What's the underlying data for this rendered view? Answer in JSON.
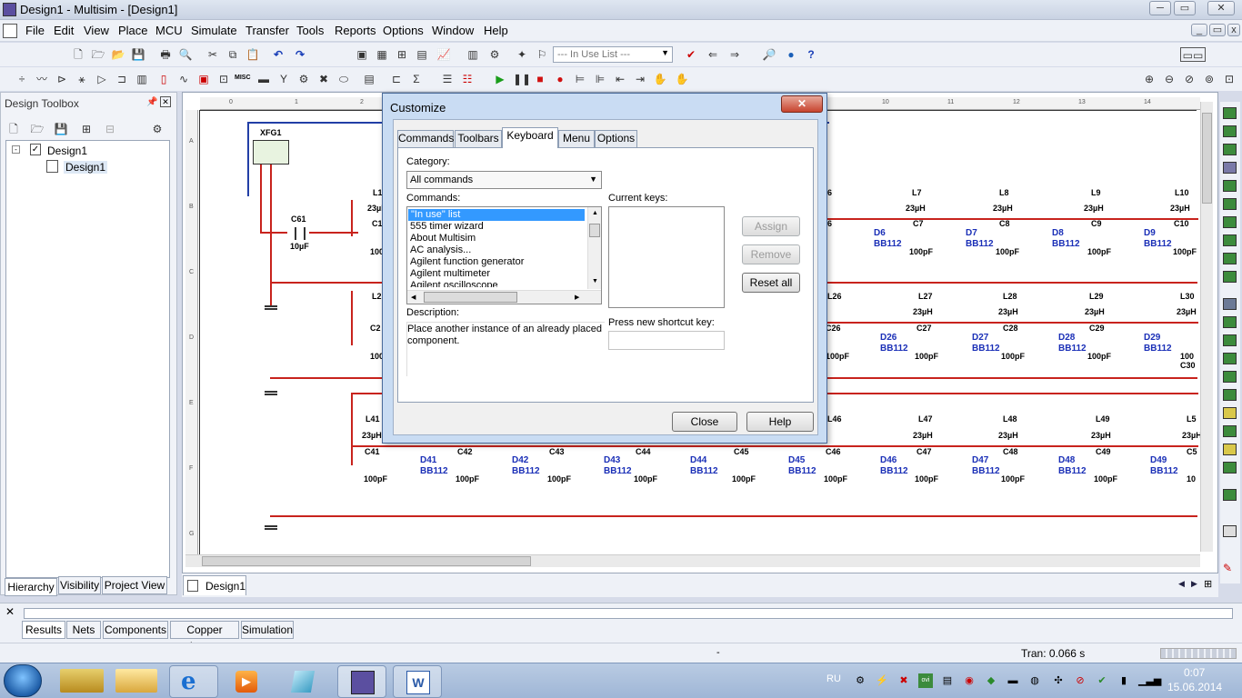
{
  "app": {
    "title": "Design1 - Multisim - [Design1]",
    "window_buttons": [
      "─",
      "▭",
      "✕"
    ]
  },
  "menu": [
    "File",
    "Edit",
    "View",
    "Place",
    "MCU",
    "Simulate",
    "Transfer",
    "Tools",
    "Reports",
    "Options",
    "Window",
    "Help"
  ],
  "toolbar": {
    "in_use_list_placeholder": "--- In Use List ---",
    "misc_label": "MISC"
  },
  "toolbox": {
    "title": "Design Toolbox",
    "tree": [
      "Design1",
      "Design1"
    ],
    "tabs": [
      "Hierarchy",
      "Visibility",
      "Project View"
    ]
  },
  "schematic": {
    "doc_tab": "Design1",
    "ruler_cols": [
      "0",
      "1",
      "2",
      "10",
      "11",
      "12",
      "13",
      "14"
    ],
    "ruler_rows": [
      "A",
      "B",
      "C",
      "D",
      "E",
      "F",
      "G"
    ],
    "xfg": "XFG1",
    "c61": {
      "name": "C61",
      "value": "10µF"
    },
    "row1": {
      "inductors": [
        "L1",
        "L7",
        "L8",
        "L9",
        "L10"
      ],
      "caps": [
        "C1",
        "C7",
        "C8",
        "C9",
        "C10",
        "6"
      ],
      "diodes": [
        "D6",
        "D7",
        "D8",
        "D9"
      ]
    },
    "row2": {
      "inductors": [
        "L2",
        "L26",
        "L27",
        "L28",
        "L29",
        "L30"
      ],
      "caps": [
        "C2",
        "C26",
        "C27",
        "C28",
        "C29",
        "C30"
      ],
      "diodes": [
        "D26",
        "D27",
        "D28",
        "D29"
      ]
    },
    "row3": {
      "inductors": [
        "L41",
        "L46",
        "L47",
        "L48",
        "L49",
        "L5"
      ],
      "caps": [
        "C41",
        "C42",
        "C43",
        "C44",
        "C45",
        "C46",
        "C47",
        "C48",
        "C49",
        "C5"
      ],
      "diodes": [
        "D41",
        "D42",
        "D43",
        "D44",
        "D45",
        "D46",
        "D47",
        "D48",
        "D49"
      ]
    },
    "inductance": "23µH",
    "capacitance": "100pF",
    "diode_model": "BB112",
    "trunc_cap": "100",
    "trunc_cap2": "10"
  },
  "dialog": {
    "title": "Customize",
    "close": "✕",
    "tabs": [
      "Commands",
      "Toolbars",
      "Keyboard",
      "Menu",
      "Options"
    ],
    "active_tab": "Keyboard",
    "category_label": "Category:",
    "category_value": "All commands",
    "commands_label": "Commands:",
    "commands": [
      "\"In use\" list",
      "555 timer wizard",
      "About Multisim",
      "AC analysis...",
      "Agilent function generator",
      "Agilent multimeter",
      "Agilent oscilloscope"
    ],
    "current_keys_label": "Current keys:",
    "assign": "Assign",
    "remove": "Remove",
    "reset_all": "Reset all",
    "description_label": "Description:",
    "description": "Place another instance of an already placed component.",
    "shortcut_label": "Press new shortcut key:",
    "close_button": "Close",
    "help_button": "Help"
  },
  "bottom": {
    "tabs": [
      "Results",
      "Nets",
      "Components",
      "Copper layers",
      "Simulation"
    ]
  },
  "status": {
    "center": "-",
    "tran": "Tran: 0.066 s"
  },
  "taskbar": {
    "lang": "RU",
    "time": "0:07",
    "date": "15.06.2014"
  },
  "colors": {
    "wire": "#c8231d",
    "diode": "#1a2fb7",
    "accent": "#3b6fb6"
  }
}
